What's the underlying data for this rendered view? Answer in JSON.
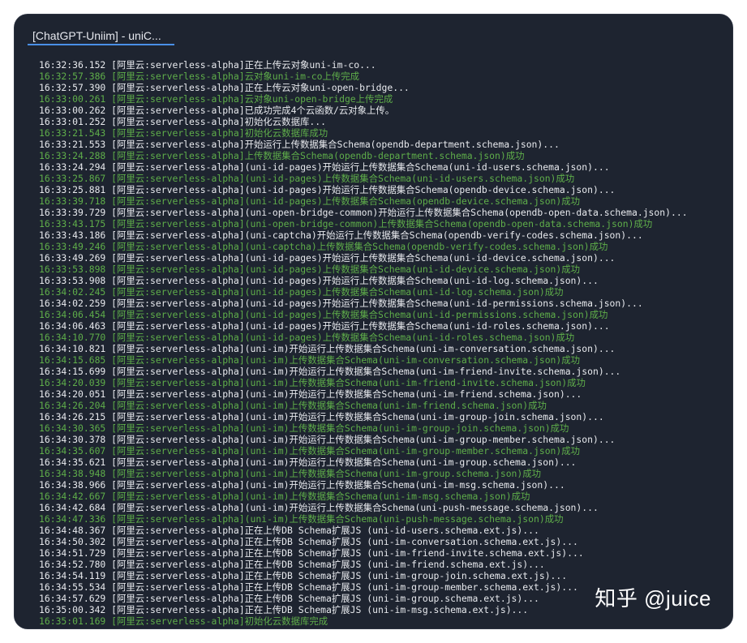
{
  "tab": {
    "title": "[ChatGPT-Uniim] - uniC..."
  },
  "watermark": "知乎 @juice",
  "colors": {
    "background": "#1e2430",
    "text": "#e8eaee",
    "success": "#5fae4a",
    "tab_underline": "#4a8fe7"
  },
  "log_lines": [
    {
      "text": "16:32:36.152 [阿里云:serverless-alpha]正在上传云对象uni-im-co...",
      "style": "white"
    },
    {
      "text": "16:32:57.386 [阿里云:serverless-alpha]云对象uni-im-co上传完成",
      "style": "green"
    },
    {
      "text": "16:32:57.390 [阿里云:serverless-alpha]正在上传云对象uni-open-bridge...",
      "style": "white"
    },
    {
      "text": "16:33:00.261 [阿里云:serverless-alpha]云对象uni-open-bridge上传完成",
      "style": "green"
    },
    {
      "text": "16:33:00.262 [阿里云:serverless-alpha]已成功完成4个云函数/云对象上传。",
      "style": "white"
    },
    {
      "text": "16:33:01.252 [阿里云:serverless-alpha]初始化云数据库...",
      "style": "white"
    },
    {
      "text": "16:33:21.543 [阿里云:serverless-alpha]初始化云数据库成功",
      "style": "green"
    },
    {
      "text": "16:33:21.553 [阿里云:serverless-alpha]开始运行上传数据集合Schema(opendb-department.schema.json)...",
      "style": "white"
    },
    {
      "text": "16:33:24.288 [阿里云:serverless-alpha]上传数据集合Schema(opendb-department.schema.json)成功",
      "style": "green"
    },
    {
      "text": "16:33:24.294 [阿里云:serverless-alpha](uni-id-pages)开始运行上传数据集合Schema(uni-id-users.schema.json)...",
      "style": "white"
    },
    {
      "text": "16:33:25.867 [阿里云:serverless-alpha](uni-id-pages)上传数据集合Schema(uni-id-users.schema.json)成功",
      "style": "green"
    },
    {
      "text": "16:33:25.881 [阿里云:serverless-alpha](uni-id-pages)开始运行上传数据集合Schema(opendb-device.schema.json)...",
      "style": "white"
    },
    {
      "text": "16:33:39.718 [阿里云:serverless-alpha](uni-id-pages)上传数据集合Schema(opendb-device.schema.json)成功",
      "style": "green"
    },
    {
      "text": "16:33:39.729 [阿里云:serverless-alpha](uni-open-bridge-common)开始运行上传数据集合Schema(opendb-open-data.schema.json)...",
      "style": "white"
    },
    {
      "text": "16:33:43.175 [阿里云:serverless-alpha](uni-open-bridge-common)上传数据集合Schema(opendb-open-data.schema.json)成功",
      "style": "green"
    },
    {
      "text": "16:33:43.186 [阿里云:serverless-alpha](uni-captcha)开始运行上传数据集合Schema(opendb-verify-codes.schema.json)...",
      "style": "white"
    },
    {
      "text": "16:33:49.246 [阿里云:serverless-alpha](uni-captcha)上传数据集合Schema(opendb-verify-codes.schema.json)成功",
      "style": "green"
    },
    {
      "text": "16:33:49.269 [阿里云:serverless-alpha](uni-id-pages)开始运行上传数据集合Schema(uni-id-device.schema.json)...",
      "style": "white"
    },
    {
      "text": "16:33:53.898 [阿里云:serverless-alpha](uni-id-pages)上传数据集合Schema(uni-id-device.schema.json)成功",
      "style": "green"
    },
    {
      "text": "16:33:53.908 [阿里云:serverless-alpha](uni-id-pages)开始运行上传数据集合Schema(uni-id-log.schema.json)...",
      "style": "white"
    },
    {
      "text": "16:34:02.245 [阿里云:serverless-alpha](uni-id-pages)上传数据集合Schema(uni-id-log.schema.json)成功",
      "style": "green"
    },
    {
      "text": "16:34:02.259 [阿里云:serverless-alpha](uni-id-pages)开始运行上传数据集合Schema(uni-id-permissions.schema.json)...",
      "style": "white"
    },
    {
      "text": "16:34:06.454 [阿里云:serverless-alpha](uni-id-pages)上传数据集合Schema(uni-id-permissions.schema.json)成功",
      "style": "green"
    },
    {
      "text": "16:34:06.463 [阿里云:serverless-alpha](uni-id-pages)开始运行上传数据集合Schema(uni-id-roles.schema.json)...",
      "style": "white"
    },
    {
      "text": "16:34:10.770 [阿里云:serverless-alpha](uni-id-pages)上传数据集合Schema(uni-id-roles.schema.json)成功",
      "style": "green"
    },
    {
      "text": "16:34:10.821 [阿里云:serverless-alpha](uni-im)开始运行上传数据集合Schema(uni-im-conversation.schema.json)...",
      "style": "white"
    },
    {
      "text": "16:34:15.685 [阿里云:serverless-alpha](uni-im)上传数据集合Schema(uni-im-conversation.schema.json)成功",
      "style": "green"
    },
    {
      "text": "16:34:15.699 [阿里云:serverless-alpha](uni-im)开始运行上传数据集合Schema(uni-im-friend-invite.schema.json)...",
      "style": "white"
    },
    {
      "text": "16:34:20.039 [阿里云:serverless-alpha](uni-im)上传数据集合Schema(uni-im-friend-invite.schema.json)成功",
      "style": "green"
    },
    {
      "text": "16:34:20.051 [阿里云:serverless-alpha](uni-im)开始运行上传数据集合Schema(uni-im-friend.schema.json)...",
      "style": "white"
    },
    {
      "text": "16:34:26.204 [阿里云:serverless-alpha](uni-im)上传数据集合Schema(uni-im-friend.schema.json)成功",
      "style": "green"
    },
    {
      "text": "16:34:26.215 [阿里云:serverless-alpha](uni-im)开始运行上传数据集合Schema(uni-im-group-join.schema.json)...",
      "style": "white"
    },
    {
      "text": "16:34:30.365 [阿里云:serverless-alpha](uni-im)上传数据集合Schema(uni-im-group-join.schema.json)成功",
      "style": "green"
    },
    {
      "text": "16:34:30.378 [阿里云:serverless-alpha](uni-im)开始运行上传数据集合Schema(uni-im-group-member.schema.json)...",
      "style": "white"
    },
    {
      "text": "16:34:35.607 [阿里云:serverless-alpha](uni-im)上传数据集合Schema(uni-im-group-member.schema.json)成功",
      "style": "green"
    },
    {
      "text": "16:34:35.621 [阿里云:serverless-alpha](uni-im)开始运行上传数据集合Schema(uni-im-group.schema.json)...",
      "style": "white"
    },
    {
      "text": "16:34:38.948 [阿里云:serverless-alpha](uni-im)上传数据集合Schema(uni-im-group.schema.json)成功",
      "style": "green"
    },
    {
      "text": "16:34:38.966 [阿里云:serverless-alpha](uni-im)开始运行上传数据集合Schema(uni-im-msg.schema.json)...",
      "style": "white"
    },
    {
      "text": "16:34:42.667 [阿里云:serverless-alpha](uni-im)上传数据集合Schema(uni-im-msg.schema.json)成功",
      "style": "green"
    },
    {
      "text": "16:34:42.684 [阿里云:serverless-alpha](uni-im)开始运行上传数据集合Schema(uni-push-message.schema.json)...",
      "style": "white"
    },
    {
      "text": "16:34:47.336 [阿里云:serverless-alpha](uni-im)上传数据集合Schema(uni-push-message.schema.json)成功",
      "style": "green"
    },
    {
      "text": "16:34:48.367 [阿里云:serverless-alpha]正在上传DB Schema扩展JS (uni-id-users.schema.ext.js)...",
      "style": "white"
    },
    {
      "text": "16:34:50.302 [阿里云:serverless-alpha]正在上传DB Schema扩展JS (uni-im-conversation.schema.ext.js)...",
      "style": "white"
    },
    {
      "text": "16:34:51.729 [阿里云:serverless-alpha]正在上传DB Schema扩展JS (uni-im-friend-invite.schema.ext.js)...",
      "style": "white"
    },
    {
      "text": "16:34:52.780 [阿里云:serverless-alpha]正在上传DB Schema扩展JS (uni-im-friend.schema.ext.js)...",
      "style": "white"
    },
    {
      "text": "16:34:54.119 [阿里云:serverless-alpha]正在上传DB Schema扩展JS (uni-im-group-join.schema.ext.js)...",
      "style": "white"
    },
    {
      "text": "16:34:55.534 [阿里云:serverless-alpha]正在上传DB Schema扩展JS (uni-im-group-member.schema.ext.js)...",
      "style": "white"
    },
    {
      "text": "16:34:57.629 [阿里云:serverless-alpha]正在上传DB Schema扩展JS (uni-im-group.schema.ext.js)...",
      "style": "white"
    },
    {
      "text": "16:35:00.342 [阿里云:serverless-alpha]正在上传DB Schema扩展JS (uni-im-msg.schema.ext.js)...",
      "style": "white"
    },
    {
      "text": "16:35:01.169 [阿里云:serverless-alpha]初始化云数据库完成",
      "style": "green"
    }
  ]
}
